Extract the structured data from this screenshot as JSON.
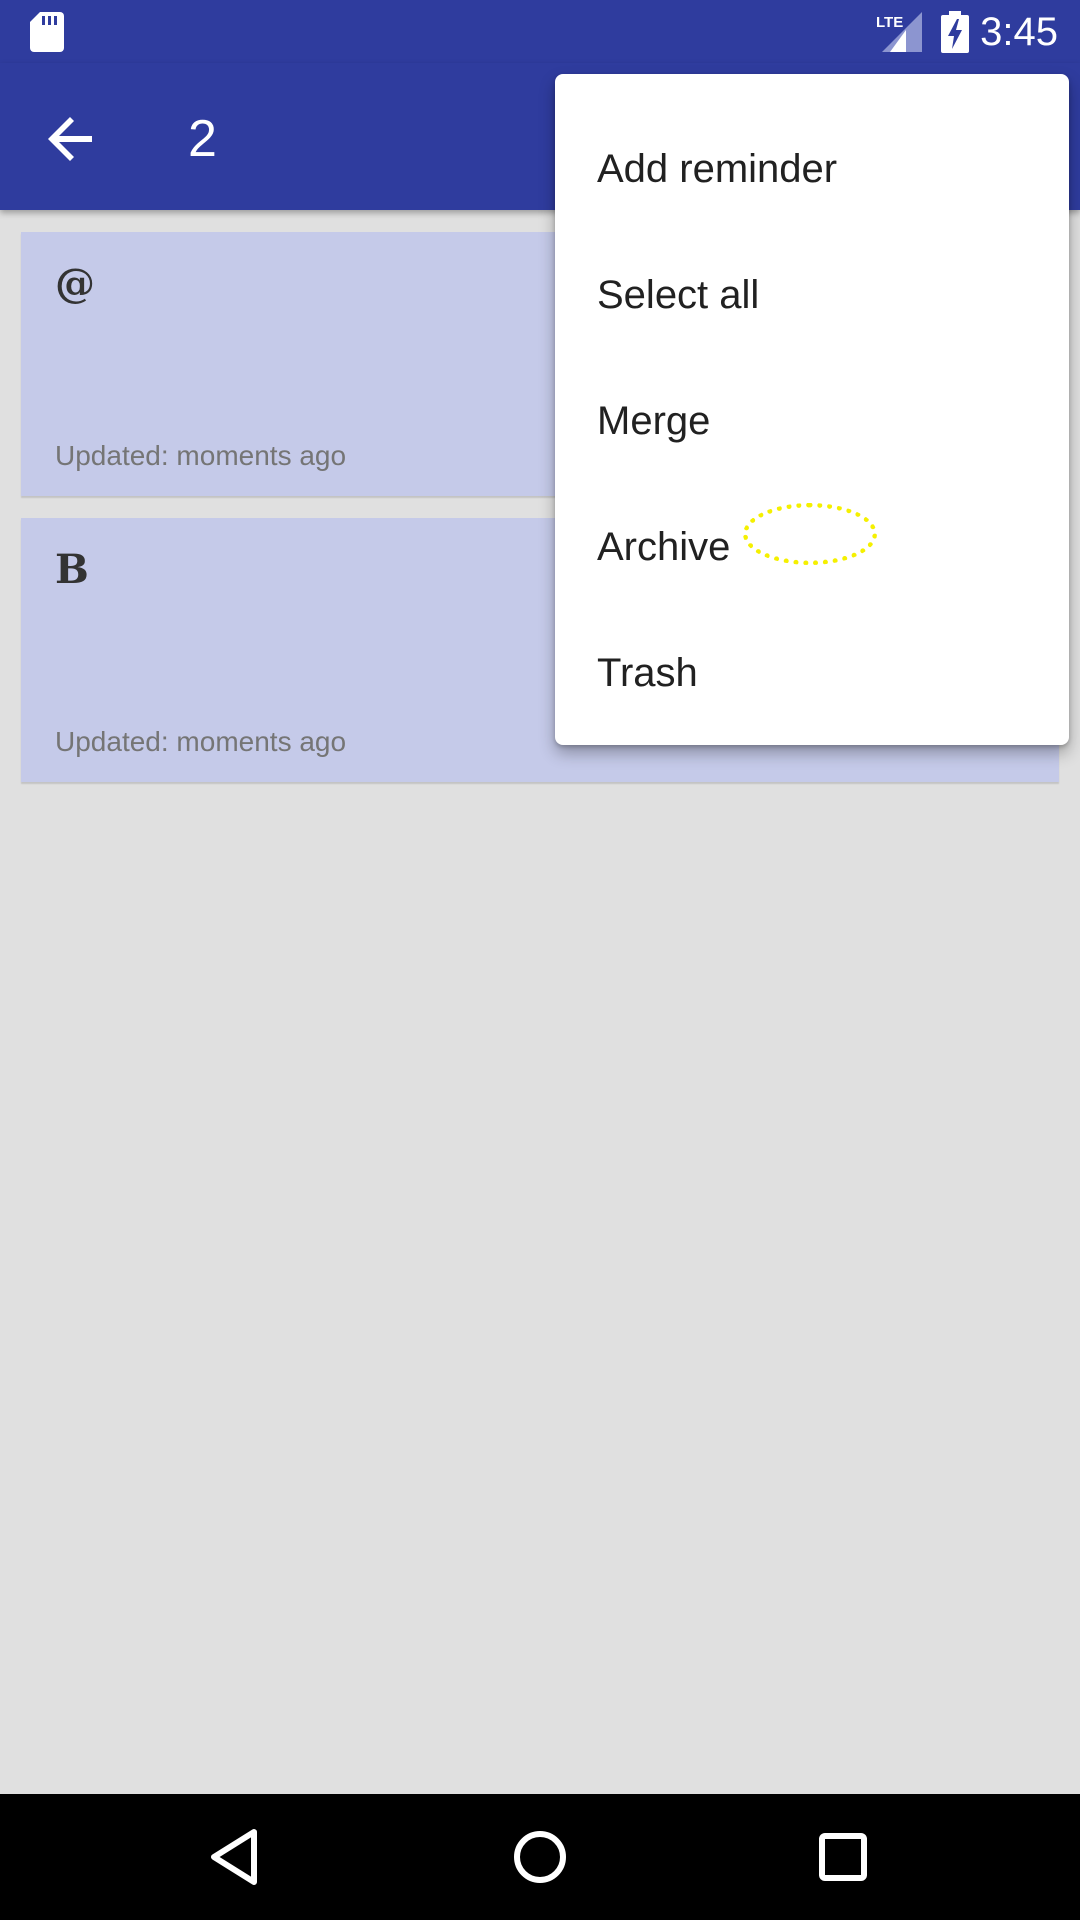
{
  "status_bar": {
    "time": "3:45",
    "network_label": "LTE",
    "icons": [
      "sd-card-icon",
      "lte-signal-icon",
      "battery-charging-icon"
    ]
  },
  "app_bar": {
    "selected_count": "2",
    "back_icon": "arrow-back-icon",
    "color": "#2f3c9e"
  },
  "notes": [
    {
      "title": "@",
      "updated": "Updated: moments ago"
    },
    {
      "title": "B",
      "updated": "Updated: moments ago"
    }
  ],
  "menu": {
    "items": [
      {
        "label": "Add reminder"
      },
      {
        "label": "Select all"
      },
      {
        "label": "Merge"
      },
      {
        "label": "Archive"
      },
      {
        "label": "Trash"
      }
    ]
  },
  "colors": {
    "primary": "#2f3c9e",
    "card": "#c5cae9",
    "background": "#e0e0e0",
    "tap_highlight": "#f5f000"
  },
  "nav_bar": {
    "icons": [
      "back-triangle-icon",
      "home-circle-icon",
      "recents-square-icon"
    ]
  }
}
